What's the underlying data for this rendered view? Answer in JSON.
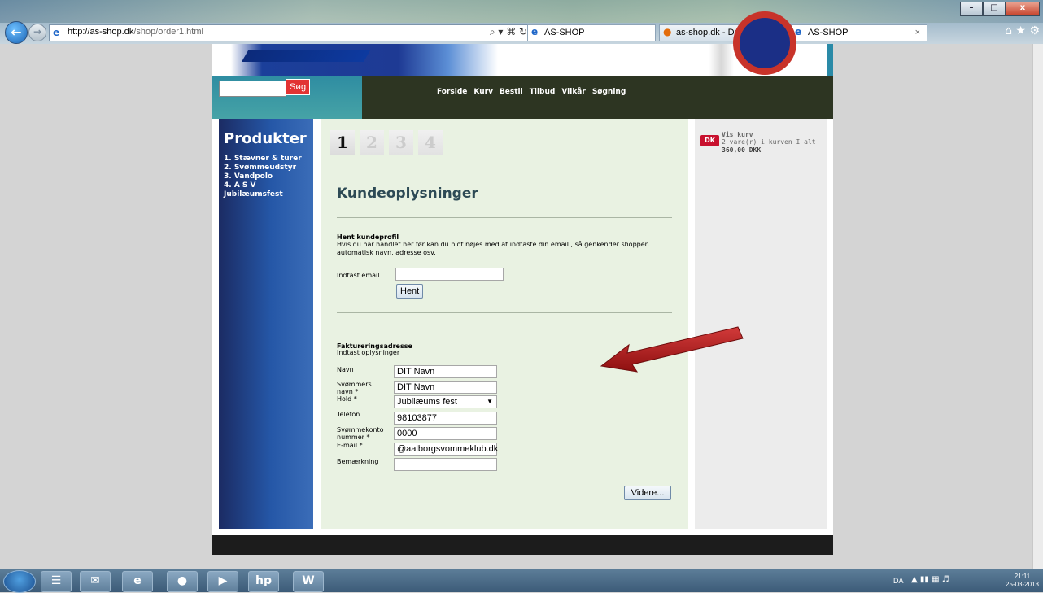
{
  "browser": {
    "address": {
      "domain": "http://as-shop.dk",
      "path": "/shop/order1.html"
    },
    "address_tools": "⌕ ▾ ⌘ ↻ ✕",
    "tabs": [
      {
        "label": "AS-SHOP"
      },
      {
        "label": "as-shop.dk - DanDomain Web..."
      },
      {
        "label": "AS-SHOP"
      }
    ],
    "window_buttons": [
      "–",
      "□",
      "x"
    ]
  },
  "site": {
    "search": {
      "button": "Søg",
      "value": ""
    },
    "nav": [
      "Forside",
      "Kurv",
      "Bestil",
      "Tilbud",
      "Vilkår",
      "Søgning"
    ],
    "products": {
      "title": "Produkter",
      "items": [
        "1. Stævner & turer",
        "2. Svømmeudstyr",
        "3. Vandpolo",
        "4. A S V",
        "Jubilæumsfest"
      ]
    },
    "steps": [
      "1",
      "2",
      "3",
      "4"
    ],
    "page_title": "Kundeoplysninger",
    "profile": {
      "heading": "Hent kundeprofil",
      "text": "Hvis du har handlet her før kan du blot nøjes med at indtaste din email , så genkender shoppen automatisk navn, adresse osv.",
      "email_label": "Indtast email",
      "email_value": "",
      "button": "Hent"
    },
    "billing": {
      "heading": "Faktureringsadresse",
      "subheading": "Indtast oplysninger",
      "fields": {
        "navn": {
          "label": "Navn",
          "value": "DIT Navn"
        },
        "svoemmers": {
          "label": "Svømmers navn *",
          "value": "DIT Navn"
        },
        "hold": {
          "label": "Hold *",
          "value": "Jubilæums fest"
        },
        "telefon": {
          "label": "Telefon",
          "value": "98103877"
        },
        "konto": {
          "label": "Svømmekonto nummer *",
          "value": "0000"
        },
        "email": {
          "label": "E-mail *",
          "value": "@aalborgsvommeklub.dk"
        },
        "bemaerkning": {
          "label": "Bemærkning",
          "value": ""
        }
      },
      "button": "Videre..."
    },
    "cart": {
      "badge": "DK",
      "link": "Vis kurv",
      "info_prefix": "2 vare(r) i kurven I alt ",
      "total": "360,00 DKK"
    }
  },
  "taskbar": {
    "apps": [
      "☰",
      "✉",
      "e",
      "●",
      "▶",
      "hp",
      "W"
    ],
    "language": "DA",
    "time": "21:11",
    "date": "25-03-2013"
  },
  "colors": {
    "nav_bg": "#2d3522",
    "search_button": "#e23333",
    "main_bg": "#e9f2e2",
    "title": "#2d4a55",
    "arrow": "#b01818"
  }
}
